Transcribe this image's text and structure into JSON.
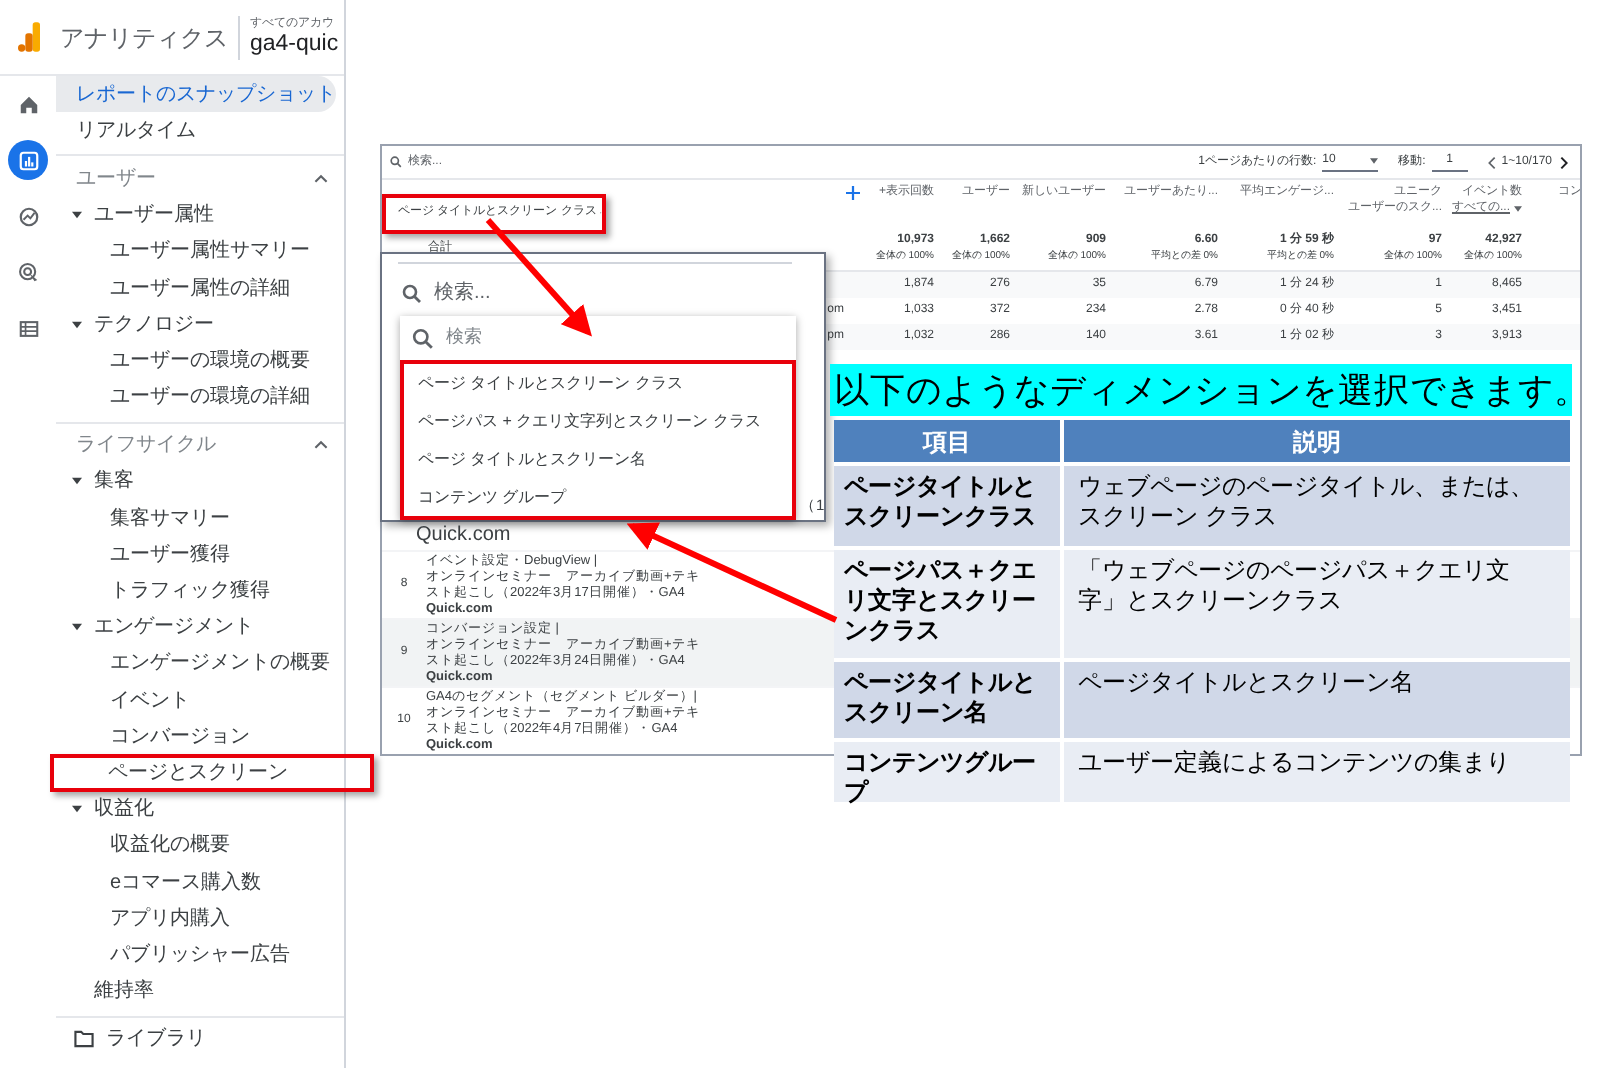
{
  "sidebar": {
    "product": "アナリティクス",
    "account_label": "すべてのアカウ",
    "property": "ga4-quic",
    "rail": [
      {
        "kind": "home",
        "selected": false
      },
      {
        "kind": "reports",
        "selected": true
      },
      {
        "kind": "explore",
        "selected": false
      },
      {
        "kind": "advertising",
        "selected": false
      },
      {
        "kind": "configure",
        "selected": false
      }
    ],
    "top_items": [
      {
        "label": "レポートのスナップショット",
        "selected": true,
        "highlighted": false
      },
      {
        "label": "リアルタイム",
        "selected": false,
        "highlighted": false
      }
    ],
    "sections": [
      {
        "label": "ユーザー",
        "expanded": true,
        "children": [
          {
            "label": "ユーザー属性",
            "expanded": true,
            "children": [
              {
                "label": "ユーザー属性サマリー",
                "selected": false,
                "highlighted": false
              },
              {
                "label": "ユーザー属性の詳細",
                "selected": false,
                "highlighted": false
              }
            ]
          },
          {
            "label": "テクノロジー",
            "expanded": true,
            "children": [
              {
                "label": "ユーザーの環境の概要",
                "selected": false,
                "highlighted": false
              },
              {
                "label": "ユーザーの環境の詳細",
                "selected": false,
                "highlighted": false
              }
            ]
          }
        ]
      },
      {
        "label": "ライフサイクル",
        "expanded": true,
        "children": [
          {
            "label": "集客",
            "expanded": true,
            "children": [
              {
                "label": "集客サマリー",
                "selected": false,
                "highlighted": false
              },
              {
                "label": "ユーザー獲得",
                "selected": false,
                "highlighted": false
              },
              {
                "label": "トラフィック獲得",
                "selected": false,
                "highlighted": false
              }
            ]
          },
          {
            "label": "エンゲージメント",
            "expanded": true,
            "children": [
              {
                "label": "エンゲージメントの概要",
                "selected": false,
                "highlighted": false
              },
              {
                "label": "イベント",
                "selected": false,
                "highlighted": false
              },
              {
                "label": "コンバージョン",
                "selected": false,
                "highlighted": false
              },
              {
                "label": "ページとスクリーン",
                "selected": false,
                "highlighted": true
              }
            ]
          },
          {
            "label": "収益化",
            "expanded": true,
            "children": [
              {
                "label": "収益化の概要",
                "selected": false,
                "highlighted": false
              },
              {
                "label": "eコマース購入数",
                "selected": false,
                "highlighted": false
              },
              {
                "label": "アプリ内購入",
                "selected": false,
                "highlighted": false
              },
              {
                "label": "パブリッシャー広告",
                "selected": false,
                "highlighted": false
              }
            ]
          },
          {
            "label": "維持率",
            "selected": false,
            "highlighted": false
          }
        ]
      }
    ],
    "library": "ライブラリ"
  },
  "report": {
    "search_placeholder": "検索...",
    "rows_per_page_label": "1ページあたりの行数:",
    "rows_per_page": "10",
    "goto_label": "移動:",
    "goto_value": "1",
    "range": "1~10/170",
    "dimension": {
      "label": "ページ タイトルとスクリーン クラス",
      "highlighted": true
    },
    "columns": [
      {
        "lines": [
          "+表示回数"
        ]
      },
      {
        "lines": [
          "ユーザー"
        ]
      },
      {
        "lines": [
          "新しいユーザー"
        ]
      },
      {
        "lines": [
          "ユーザーあたり..."
        ]
      },
      {
        "lines": [
          "平均エンゲージ..."
        ]
      },
      {
        "lines": [
          "ユニーク",
          "ユーザーのスク..."
        ]
      },
      {
        "lines": [
          "イベント数"
        ],
        "sub": "すべての..."
      },
      {
        "lines": [
          "コン"
        ]
      }
    ],
    "totals": {
      "label": "合計",
      "values": [
        {
          "value": "10,973",
          "note": "全体の 100%"
        },
        {
          "value": "1,662",
          "note": "全体の 100%"
        },
        {
          "value": "909",
          "note": "全体の 100%"
        },
        {
          "value": "6.60",
          "note": "平均との差 0%"
        },
        {
          "value": "1 分 59 秒",
          "note": "平均との差 0%"
        },
        {
          "value": "97",
          "note": "全体の 100%"
        },
        {
          "value": "42,927",
          "note": "全体の 100%"
        }
      ]
    },
    "rows": [
      {
        "values": [
          "1,874",
          "276",
          "35",
          "6.79",
          "1 分 24 秒",
          "1",
          "8,465"
        ]
      },
      {
        "fragment": "om",
        "values": [
          "1,033",
          "372",
          "234",
          "2.78",
          "0 分 40 秒",
          "5",
          "3,451"
        ]
      },
      {
        "fragment": "pm",
        "values": [
          "1,032",
          "286",
          "140",
          "3.61",
          "1 分 02 秒",
          "3",
          "3,913"
        ]
      }
    ],
    "lower_rows": [
      {
        "number": "8",
        "shaded": false,
        "lines": [
          "イベント設定・DebugView |",
          "オンラインセミナー　アーカイブ動画+テキスト起こし（2022年3月17日開催）・GA4",
          "Quick.com"
        ]
      },
      {
        "number": "9",
        "shaded": true,
        "lines": [
          "コンバージョン設定 |",
          "オンラインセミナー　アーカイブ動画+テキスト起こし（2022年3月24日開催）・GA4",
          "Quick.com"
        ]
      },
      {
        "number": "10",
        "shaded": false,
        "lines": [
          "GA4のセグメント（セグメント ビルダー）|",
          "オンラインセミナー　アーカイブ動画+テキスト起こし（2022年4月7日開催）・GA4",
          "Quick.com"
        ]
      }
    ]
  },
  "dropdown": {
    "search_placeholder": "検索...",
    "filter_placeholder": "検索",
    "options_highlighted": true,
    "options": [
      {
        "label": "ページ タイトルとスクリーン クラス"
      },
      {
        "label": "ページパス + クエリ文字列とスクリーン クラス"
      },
      {
        "label": "ページ タイトルとスクリーン名"
      },
      {
        "label": "コンテンツ グループ"
      }
    ],
    "peek_right": "（1",
    "peek_below": "Quick.com"
  },
  "callout": {
    "text": "以下のようなディメンションを選択できます。"
  },
  "table": {
    "columns": [
      "項目",
      "説明"
    ],
    "rows": [
      {
        "item": "ページタイトルとスクリーンクラス",
        "description": "ウェブページのページタイトル、または、スクリーン クラス"
      },
      {
        "item": "ページパス＋クエリ文字とスクリーンクラス",
        "description": "「ウェブページのページパス＋クエリ文字」とスクリーンクラス"
      },
      {
        "item": "ページタイトルとスクリーン名",
        "description": "ページタイトルとスクリーン名"
      },
      {
        "item": "コンテンツグループ",
        "description": "ユーザー定義によるコンテンツの集まり"
      }
    ]
  }
}
